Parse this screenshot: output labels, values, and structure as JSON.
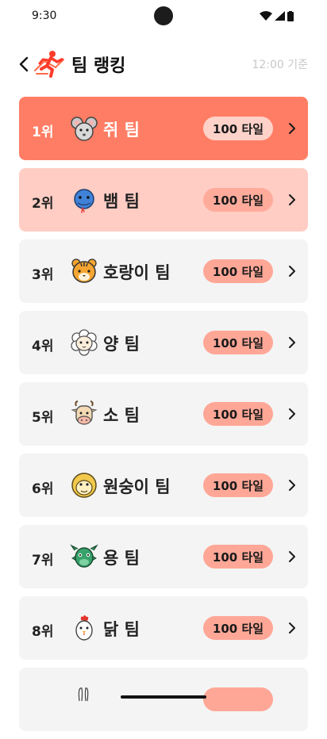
{
  "status": {
    "time": "9:30"
  },
  "header": {
    "title": "팀 랭킹",
    "time_basis": "12:00 기준"
  },
  "colors": {
    "accent": "#ff7d64",
    "accent_light": "#ffcdc4",
    "badge": "#ffa797",
    "card": "#f4f4f4"
  },
  "teams": [
    {
      "rank": "1위",
      "name": "쥐 팀",
      "tiles": "100 타일",
      "icon": "mouse-icon"
    },
    {
      "rank": "2위",
      "name": "뱀 팀",
      "tiles": "100 타일",
      "icon": "snake-icon"
    },
    {
      "rank": "3위",
      "name": "호랑이 팀",
      "tiles": "100 타일",
      "icon": "tiger-icon"
    },
    {
      "rank": "4위",
      "name": "양 팀",
      "tiles": "100 타일",
      "icon": "sheep-icon"
    },
    {
      "rank": "5위",
      "name": "소 팀",
      "tiles": "100 타일",
      "icon": "cow-icon"
    },
    {
      "rank": "6위",
      "name": "원숭이 팀",
      "tiles": "100 타일",
      "icon": "monkey-icon"
    },
    {
      "rank": "7위",
      "name": "용 팀",
      "tiles": "100 타일",
      "icon": "dragon-icon"
    },
    {
      "rank": "8위",
      "name": "닭 팀",
      "tiles": "100 타일",
      "icon": "rooster-icon"
    }
  ]
}
